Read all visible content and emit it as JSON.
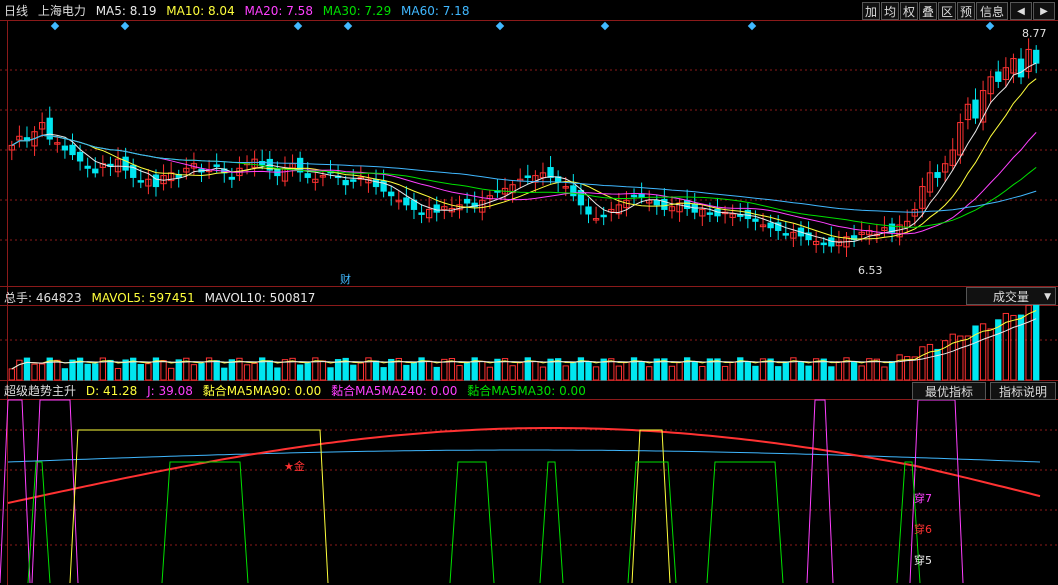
{
  "colors": {
    "up": "#ff3232",
    "down": "#00e6f0",
    "ma5": "#e8e8e8",
    "ma10": "#ffff3c",
    "ma20": "#ff40ff",
    "ma30": "#00e000",
    "ma60": "#40b8ff",
    "grid": "#8b1a1a",
    "price_label": "#e0e0e0"
  },
  "header": {
    "period": "日线",
    "stock": "上海电力",
    "ma5": "MA5: 8.19",
    "ma10": "MA10: 8.04",
    "ma20": "MA20: 7.58",
    "ma30": "MA30: 7.29",
    "ma60": "MA60: 7.18"
  },
  "toolbar": {
    "buttons": [
      "加",
      "均",
      "权",
      "叠",
      "区",
      "预"
    ],
    "info": "信息",
    "arrows": "◆"
  },
  "price_chart": {
    "high_label": "8.77",
    "low_label": "6.53",
    "fin_marker": "财"
  },
  "volume_header": {
    "total": "总手: 464823",
    "mavol5": "MAVOL5: 597451",
    "mavol10": "MAVOL10: 500817",
    "dropdown": "成交量"
  },
  "indicator_header": {
    "name": "超级趋势主升",
    "d": "D: 41.28",
    "j": "J: 39.08",
    "s1": "黏合MA5MA90: 0.00",
    "s2": "黏合MA5MA240: 0.00",
    "s3": "黏合MA5MA30: 0.00",
    "btn_best": "最优指标",
    "btn_help": "指标说明"
  },
  "signals": {
    "buy": "★金",
    "c7": "穿7",
    "c6": "穿6",
    "c5": "穿5"
  },
  "chart_data": {
    "type": "candlestick",
    "price_range": [
      6.2,
      9.0
    ],
    "closes": [
      7.65,
      7.75,
      7.7,
      7.8,
      7.9,
      7.72,
      7.68,
      7.6,
      7.55,
      7.48,
      7.4,
      7.35,
      7.45,
      7.42,
      7.5,
      7.38,
      7.3,
      7.25,
      7.28,
      7.2,
      7.32,
      7.35,
      7.3,
      7.4,
      7.45,
      7.36,
      7.38,
      7.42,
      7.35,
      7.28,
      7.4,
      7.46,
      7.5,
      7.44,
      7.38,
      7.32,
      7.4,
      7.45,
      7.36,
      7.3,
      7.28,
      7.32,
      7.36,
      7.3,
      7.22,
      7.26,
      7.3,
      7.28,
      7.2,
      7.15,
      7.1,
      7.05,
      7.0,
      6.95,
      6.9,
      6.95,
      6.92,
      6.98,
      6.96,
      7.0,
      7.02,
      6.98,
      7.05,
      7.1,
      7.15,
      7.18,
      7.22,
      7.28,
      7.3,
      7.32,
      7.35,
      7.3,
      7.25,
      7.2,
      7.1,
      7.0,
      6.9,
      6.85,
      6.88,
      6.95,
      7.0,
      7.05,
      7.1,
      7.08,
      7.05,
      7.0,
      6.95,
      6.98,
      7.02,
      6.96,
      6.92,
      6.95,
      6.9,
      6.88,
      6.92,
      6.9,
      6.88,
      6.85,
      6.82,
      6.78,
      6.75,
      6.72,
      6.68,
      6.7,
      6.66,
      6.62,
      6.6,
      6.58,
      6.55,
      6.6,
      6.65,
      6.62,
      6.7,
      6.72,
      6.68,
      6.75,
      6.7,
      6.78,
      6.82,
      6.95,
      7.2,
      7.35,
      7.3,
      7.45,
      7.6,
      7.9,
      8.1,
      7.95,
      8.25,
      8.4,
      8.35,
      8.5,
      8.6,
      8.4,
      8.7,
      8.55
    ]
  }
}
